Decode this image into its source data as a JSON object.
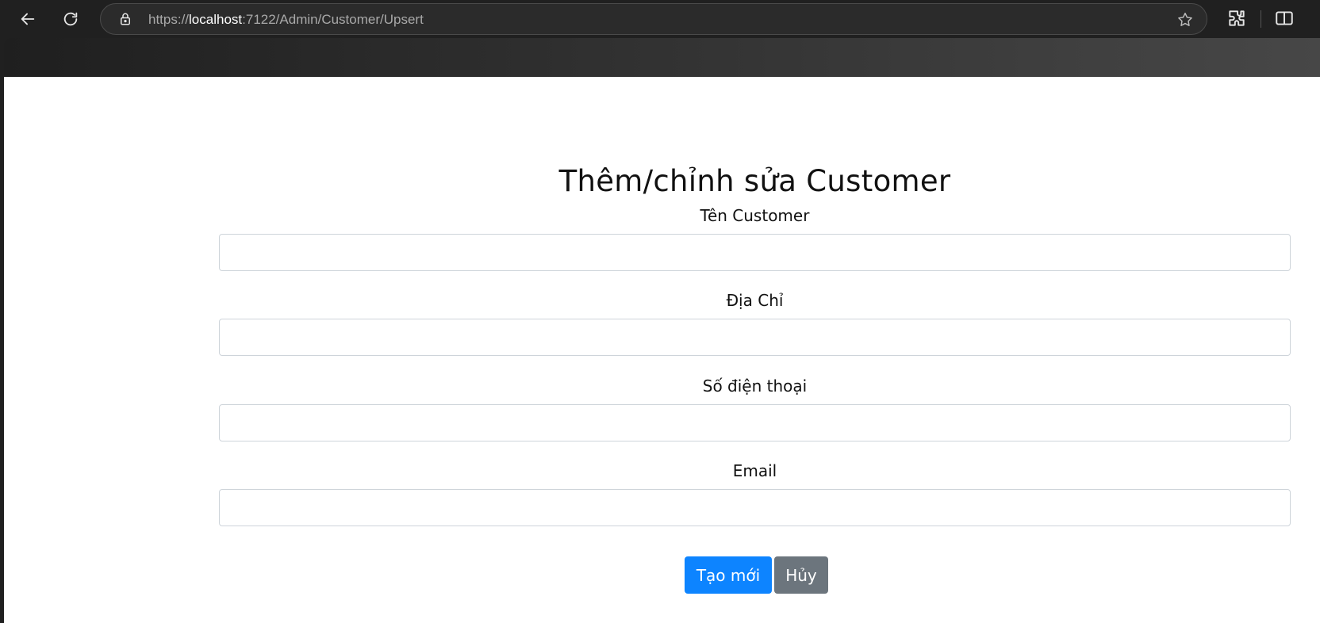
{
  "browser": {
    "url_scheme": "https://",
    "url_host": "localhost",
    "url_path": ":7122/Admin/Customer/Upsert",
    "icons": [
      "back-arrow-icon",
      "refresh-icon",
      "lock-icon",
      "star-icon",
      "extensions-icon",
      "split-screen-icon"
    ]
  },
  "form": {
    "title": "Thêm/chỉnh sửa Customer",
    "fields": [
      {
        "label": "Tên Customer",
        "value": ""
      },
      {
        "label": "Địa Chỉ",
        "value": ""
      },
      {
        "label": "Số điện thoại",
        "value": ""
      },
      {
        "label": "Email",
        "value": ""
      }
    ],
    "submit_label": "Tạo mới",
    "cancel_label": "Hủy"
  },
  "colors": {
    "primary": "#0d84ff",
    "secondary": "#6c757d",
    "chrome_bg": "#202020"
  }
}
